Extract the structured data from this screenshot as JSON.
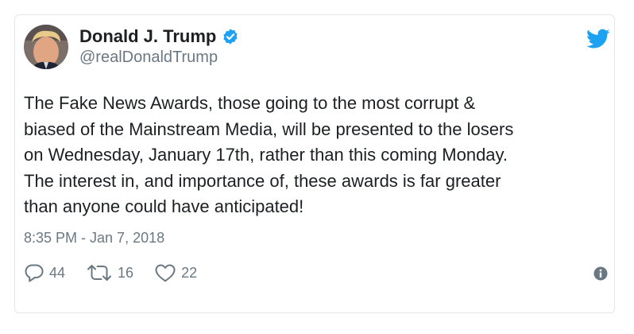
{
  "user": {
    "display_name": "Donald J. Trump",
    "handle": "@realDonaldTrump",
    "verified": true,
    "avatar_icon": "profile-photo"
  },
  "tweet": {
    "text": "The Fake News Awards, those going to the most corrupt &\nbiased of the Mainstream Media, will be presented to the losers\non Wednesday, January 17th, rather than this coming Monday.\nThe interest in, and importance of, these awards is far greater\nthan anyone could have anticipated!",
    "timestamp": "8:35 PM - Jan 7, 2018"
  },
  "actions": {
    "replies": "44",
    "retweets": "16",
    "likes": "22"
  },
  "icons": {
    "brand": "twitter-bird-icon",
    "verified": "verified-badge-icon",
    "reply": "reply-icon",
    "retweet": "retweet-icon",
    "like": "heart-icon",
    "info": "info-icon"
  },
  "colors": {
    "brand_blue": "#1da1f2",
    "text_primary": "#1c2022",
    "text_secondary": "#697882",
    "border": "#e1e8ed"
  }
}
